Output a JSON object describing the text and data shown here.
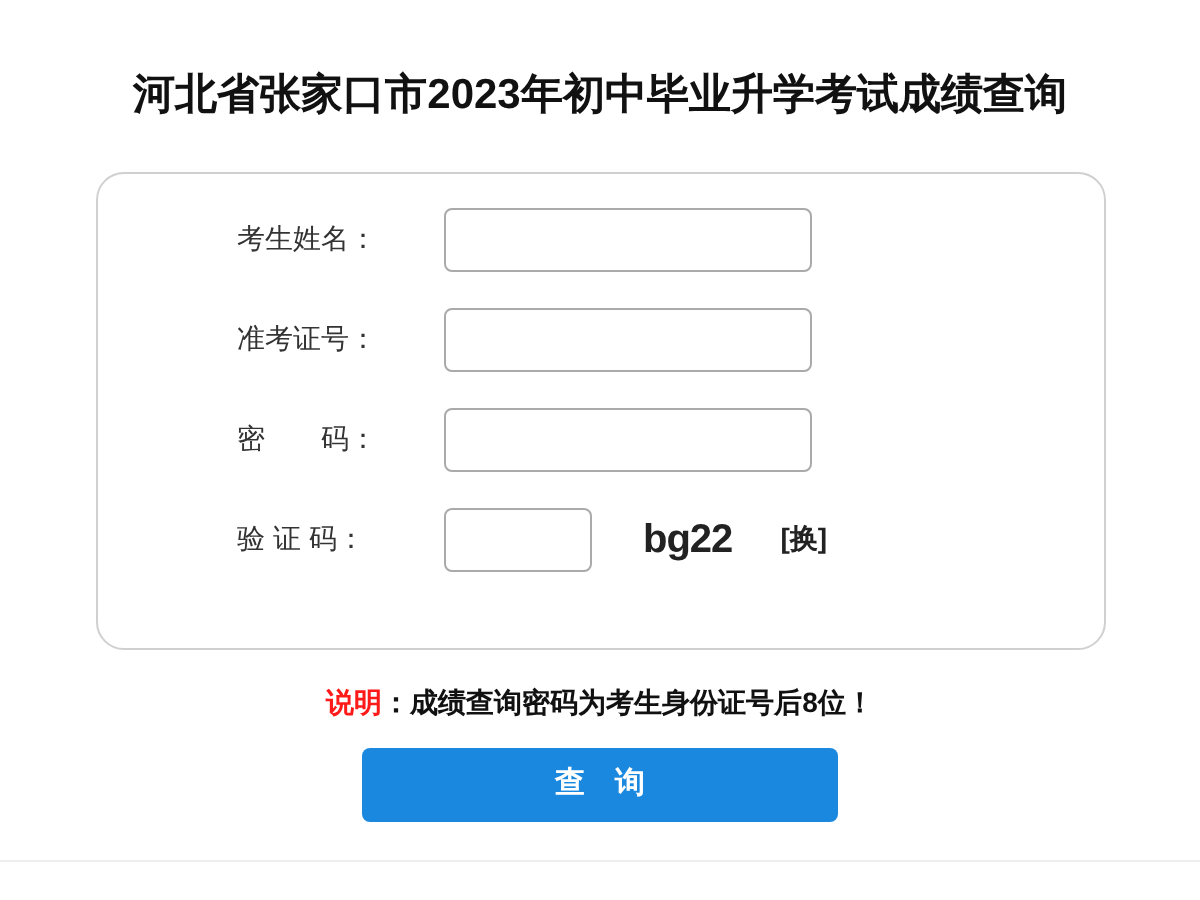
{
  "title": "河北省张家口市2023年初中毕业升学考试成绩查询",
  "fields": [
    {
      "label": "考生姓名：",
      "kind": "text"
    },
    {
      "label": "准考证号：",
      "kind": "text"
    },
    {
      "label": "密　　码：",
      "kind": "text"
    },
    {
      "label": "验 证 码：",
      "kind": "captcha",
      "captcha": "bg22",
      "refresh": "[换]"
    }
  ],
  "note": {
    "label": "说明",
    "text": "：成绩查询密码为考生身份证号后8位！"
  },
  "submit": "查　询"
}
